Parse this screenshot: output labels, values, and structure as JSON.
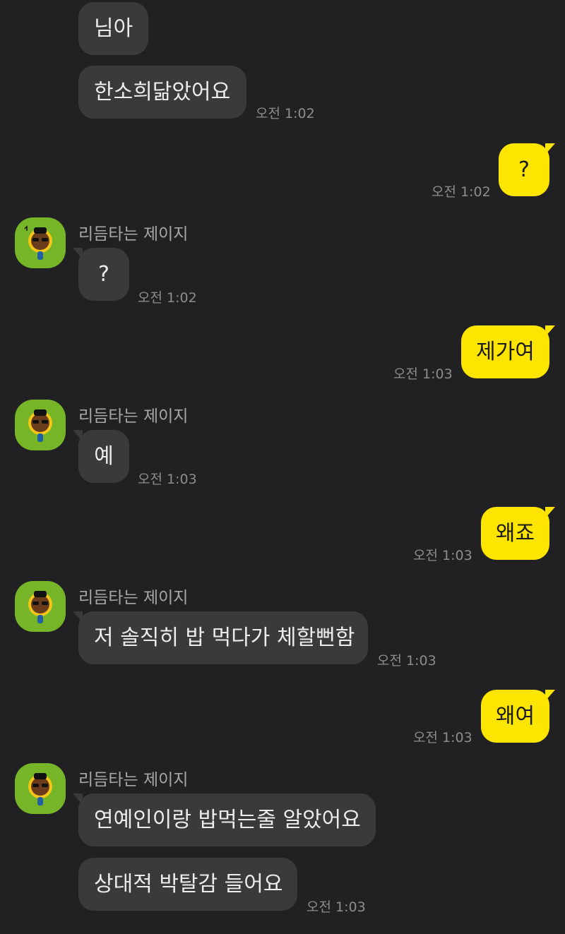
{
  "sender_name": "리듬타는 제이지",
  "colors": {
    "background": "#212123",
    "incoming_bubble": "#3a3a3c",
    "outgoing_bubble": "#fee500",
    "avatar_bg": "#75b527"
  },
  "avatar_icon": "character-avatar-icon",
  "messages": [
    {
      "dir": "in",
      "text": "님아"
    },
    {
      "dir": "in",
      "text": "한소희닮았어요",
      "time": "오전 1:02"
    },
    {
      "dir": "out",
      "text": "?",
      "time": "오전 1:02"
    },
    {
      "dir": "in",
      "text": "?",
      "time": "오전 1:02"
    },
    {
      "dir": "out",
      "text": "제가여",
      "time": "오전 1:03"
    },
    {
      "dir": "in",
      "text": "예",
      "time": "오전 1:03"
    },
    {
      "dir": "out",
      "text": "왜죠",
      "time": "오전 1:03"
    },
    {
      "dir": "in",
      "text": "저 솔직히 밥 먹다가 체할뻔함",
      "time": "오전 1:03"
    },
    {
      "dir": "out",
      "text": "왜여",
      "time": "오전 1:03"
    },
    {
      "dir": "in",
      "text": "연예인이랑 밥먹는줄 알았어요"
    },
    {
      "dir": "in",
      "text": "상대적 박탈감 들어요",
      "time": "오전 1:03"
    }
  ]
}
